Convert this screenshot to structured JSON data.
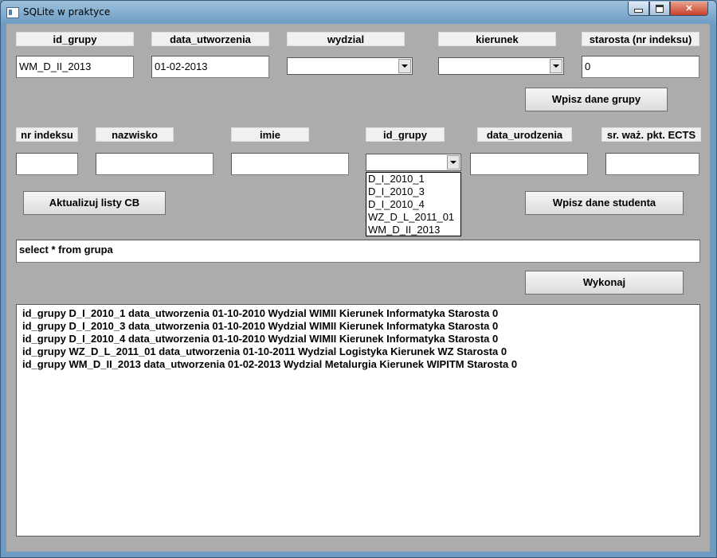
{
  "window": {
    "title": "SQLite w praktyce"
  },
  "group": {
    "labels": [
      "id_grupy",
      "data_utworzenia",
      "wydzial",
      "kierunek",
      "starosta (nr indeksu)"
    ],
    "id_grupy_value": "WM_D_II_2013",
    "data_utworzenia_value": "01-02-2013",
    "wydzial_value": "",
    "kierunek_value": "",
    "starosta_value": "0",
    "submit_label": "Wpisz dane grupy"
  },
  "student": {
    "labels": [
      "nr indeksu",
      "nazwisko",
      "imie",
      "id_grupy",
      "data_urodzenia",
      "sr. waż. pkt. ECTS"
    ],
    "nr_indeksu_value": "",
    "nazwisko_value": "",
    "imie_value": "",
    "id_grupy_value": "",
    "data_urodzenia_value": "",
    "ects_value": "",
    "refresh_label": "Aktualizuj listy CB",
    "submit_label": "Wpisz dane studenta",
    "id_grupy_options": [
      "D_I_2010_1",
      "D_I_2010_3",
      "D_I_2010_4",
      "WZ_D_L_2011_01",
      "WM_D_II_2013"
    ]
  },
  "query": {
    "value": "select * from grupa",
    "execute_label": "Wykonaj"
  },
  "results": [
    "id_grupy D_I_2010_1 data_utworzenia 01-10-2010 Wydzial WIMII Kierunek Informatyka Starosta 0",
    "id_grupy D_I_2010_3 data_utworzenia 01-10-2010 Wydzial WIMII Kierunek Informatyka Starosta 0",
    "id_grupy D_I_2010_4 data_utworzenia 01-10-2010 Wydzial WIMII Kierunek Informatyka Starosta 0",
    "id_grupy WZ_D_L_2011_01 data_utworzenia 01-10-2011 Wydzial Logistyka Kierunek WZ Starosta 0",
    "id_grupy WM_D_II_2013 data_utworzenia 01-02-2013 Wydzial Metalurgia Kierunek WIPITM Starosta 0"
  ]
}
